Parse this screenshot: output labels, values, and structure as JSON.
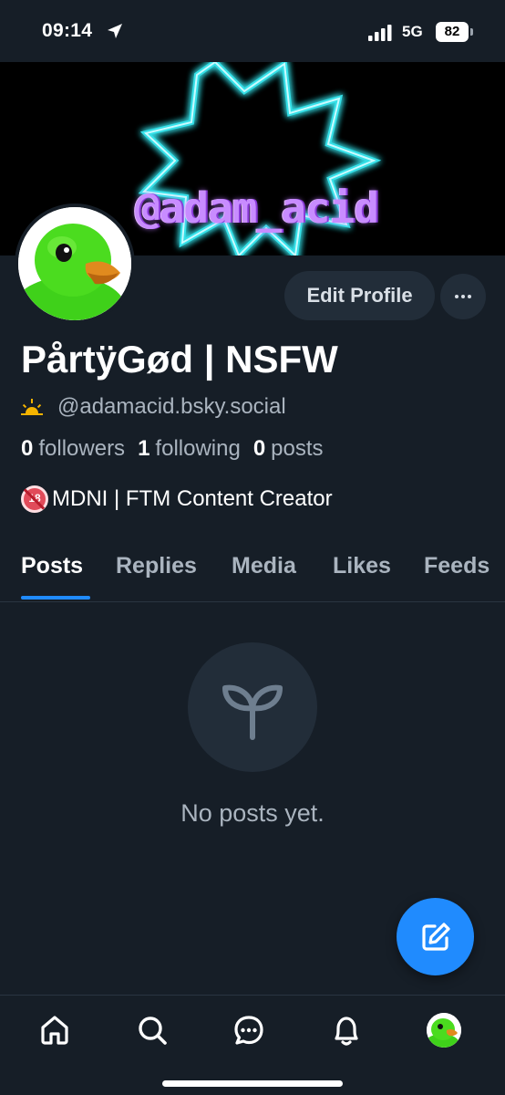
{
  "status_bar": {
    "time": "09:14",
    "network": "5G",
    "battery": "82",
    "icons": [
      "location-arrow-icon",
      "signal-bars-icon",
      "battery-icon"
    ]
  },
  "banner": {
    "text": "@adam_acid",
    "colors": {
      "background": "#000000",
      "star_glow": "#35e0e8",
      "text": "#c88cff"
    }
  },
  "profile": {
    "display_name": "PårtÿGød | NSFW",
    "handle_prefix_icon": "sun-emoji-icon",
    "handle": "@adamacid.bsky.social",
    "followers_count": "0",
    "followers_label": "followers",
    "following_count": "1",
    "following_label": "following",
    "posts_count": "0",
    "posts_label": "posts",
    "bio_icon": "no-under-18-emoji-icon",
    "bio": "MDNI | FTM Content Creator",
    "edit_label": "Edit Profile"
  },
  "tabs": [
    {
      "label": "Posts",
      "active": true
    },
    {
      "label": "Replies",
      "active": false
    },
    {
      "label": "Media",
      "active": false
    },
    {
      "label": "Likes",
      "active": false
    },
    {
      "label": "Feeds",
      "active": false
    }
  ],
  "empty_state": {
    "icon": "seedling-icon",
    "text": "No posts yet."
  },
  "fab": {
    "icon": "compose-icon"
  },
  "bottom_nav": {
    "items": [
      "home-icon",
      "search-icon",
      "chat-icon",
      "bell-icon",
      "profile-avatar"
    ]
  },
  "colors": {
    "background": "#161e27",
    "surface": "#222d39",
    "accent": "#208bfe",
    "muted_text": "#aab4bf"
  }
}
